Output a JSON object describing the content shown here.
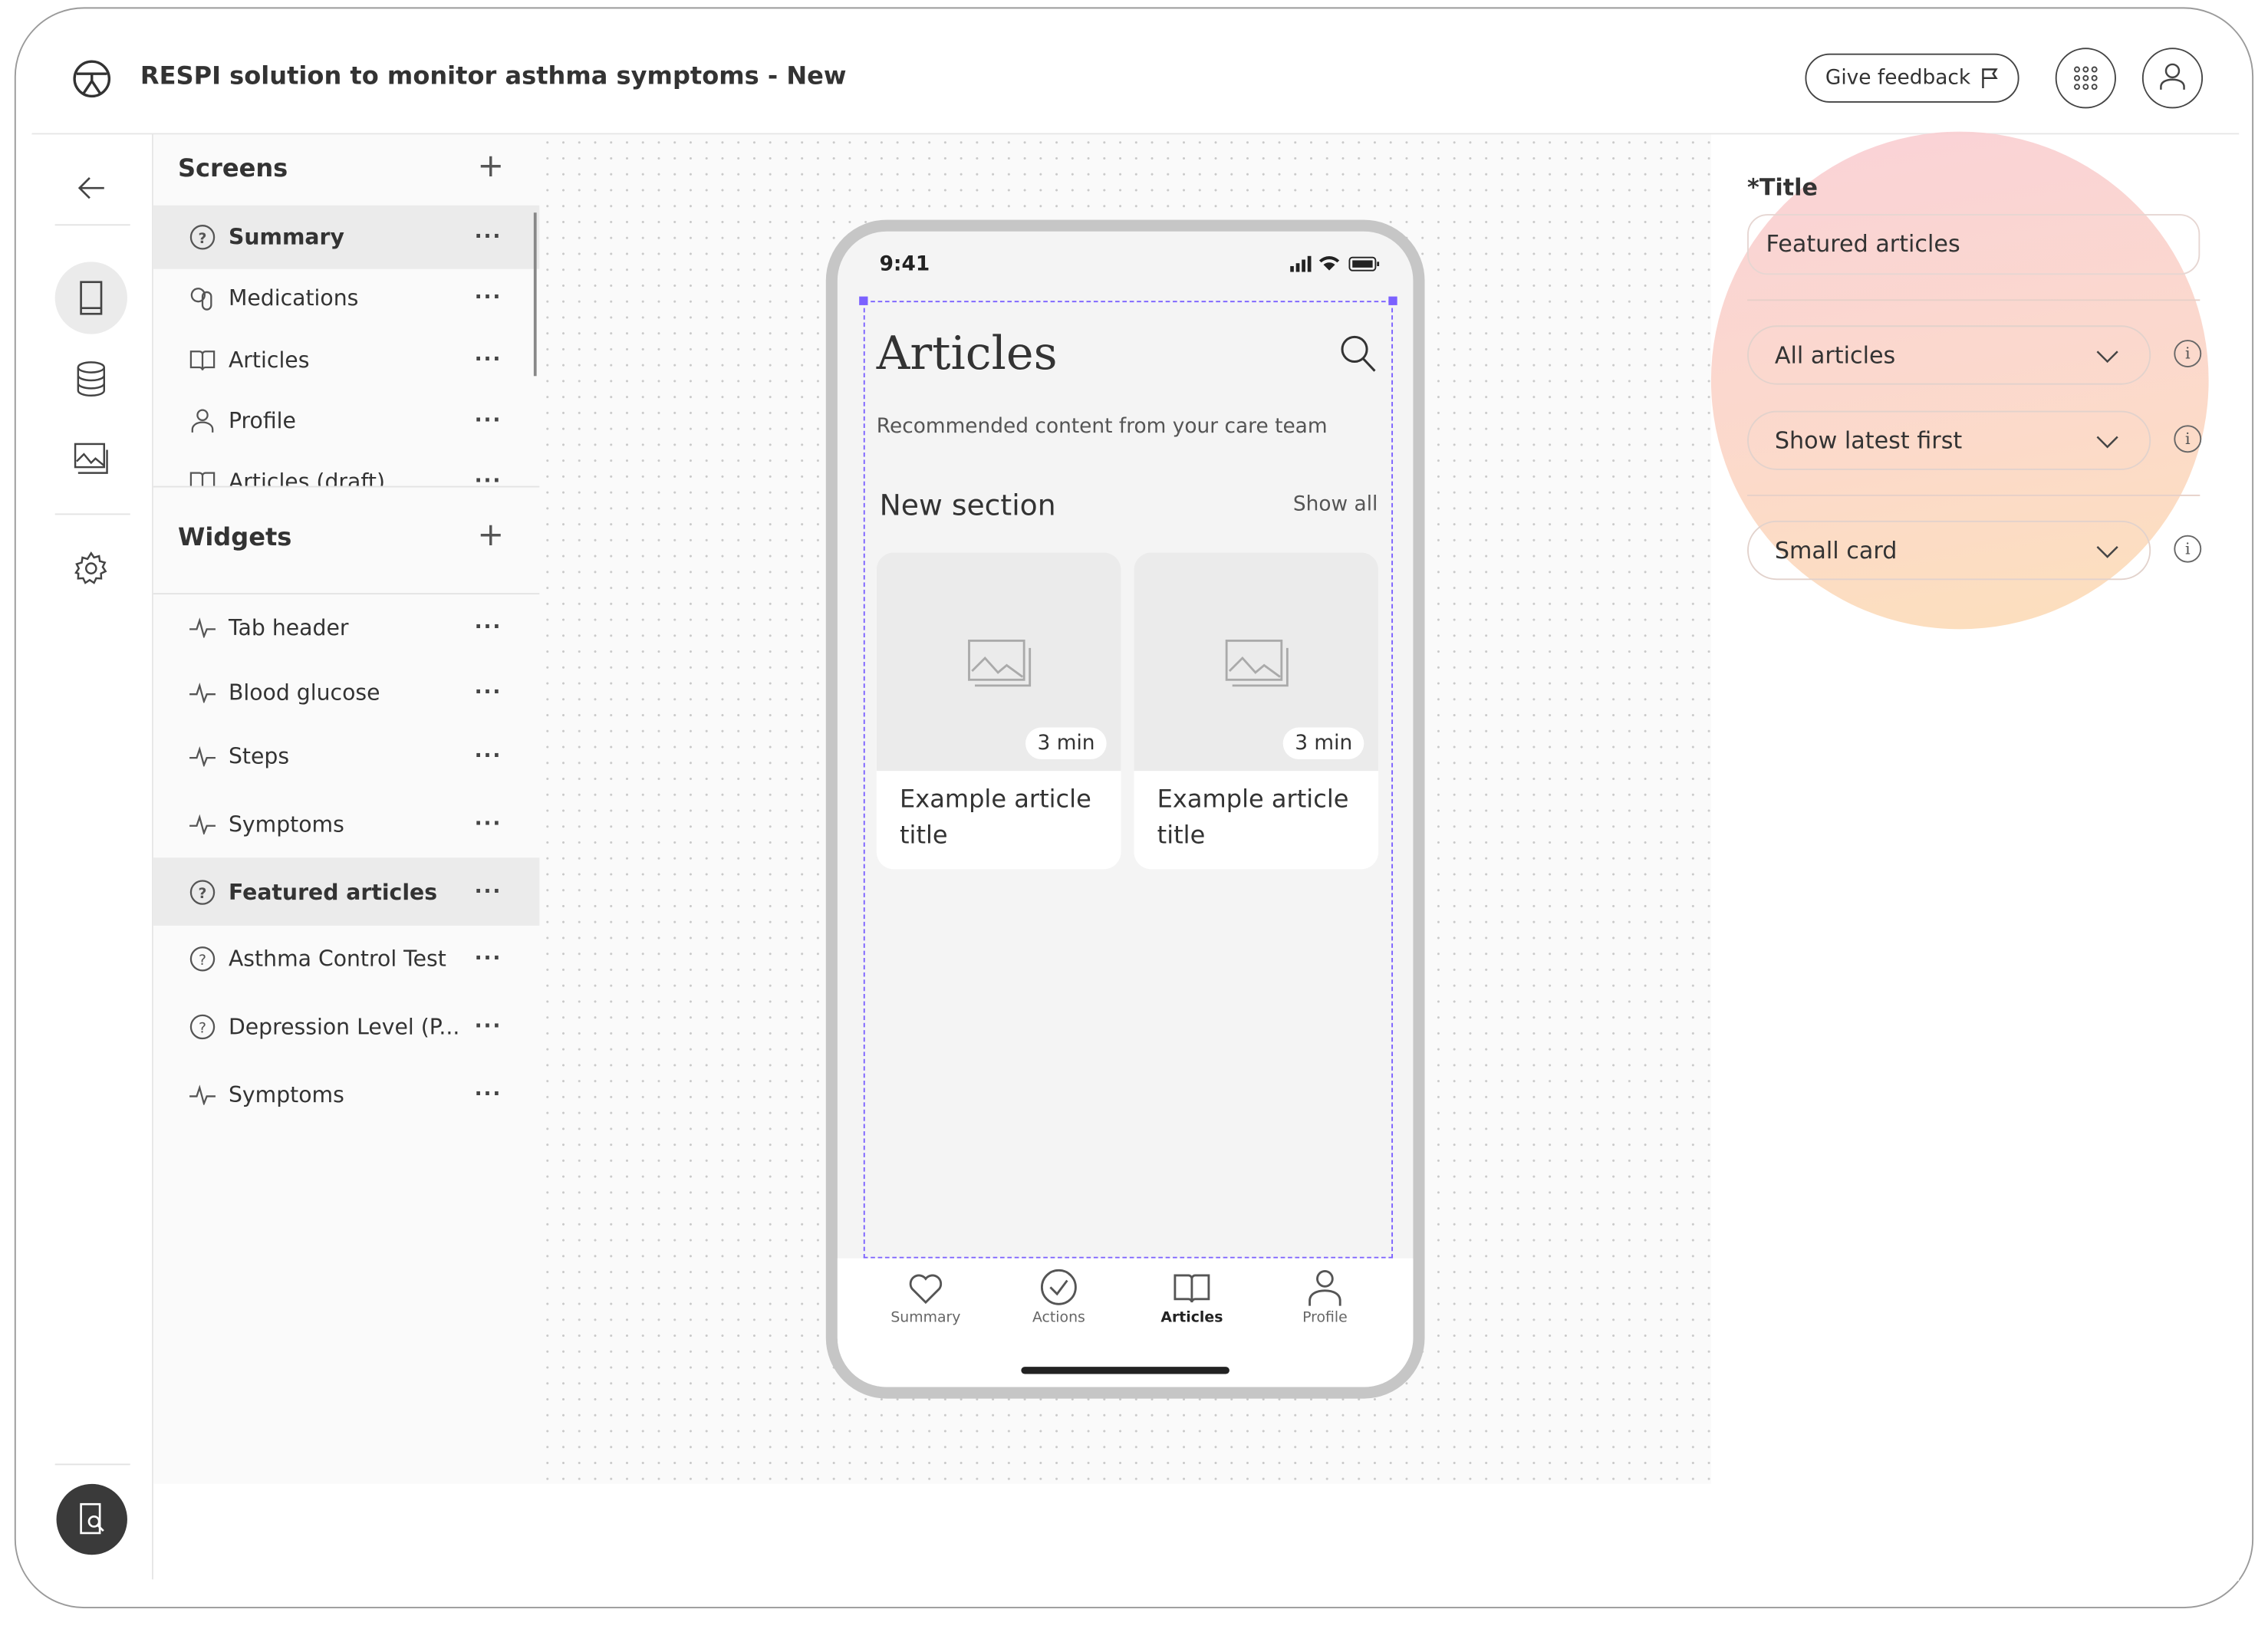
{
  "header": {
    "title": "RESPI solution to monitor asthma symptoms - New",
    "feedback_label": "Give feedback"
  },
  "rail": {
    "icons": [
      "back-arrow-icon",
      "phone-icon",
      "database-icon",
      "image-icon",
      "gear-icon",
      "preview-icon"
    ]
  },
  "screens": {
    "title": "Screens",
    "items": [
      {
        "label": "Summary",
        "icon": "question-circle-icon",
        "selected": true
      },
      {
        "label": "Medications",
        "icon": "pills-icon"
      },
      {
        "label": "Articles",
        "icon": "book-icon"
      },
      {
        "label": "Profile",
        "icon": "person-icon"
      },
      {
        "label": "Articles (draft)",
        "icon": "book-icon"
      }
    ]
  },
  "widgets": {
    "title": "Widgets",
    "items": [
      {
        "label": "Tab header",
        "icon": "pulse-icon"
      },
      {
        "label": "Blood glucose",
        "icon": "pulse-icon"
      },
      {
        "label": "Steps",
        "icon": "pulse-icon"
      },
      {
        "label": "Symptoms",
        "icon": "pulse-icon"
      },
      {
        "label": "Featured articles",
        "icon": "question-circle-icon",
        "selected": true
      },
      {
        "label": "Asthma Control Test",
        "icon": "question-circle-icon"
      },
      {
        "label": "Depression Level (P...",
        "icon": "question-circle-icon"
      },
      {
        "label": "Symptoms",
        "icon": "pulse-icon"
      }
    ]
  },
  "phone": {
    "time": "9:41",
    "title": "Articles",
    "subtitle": "Recommended content from your care team",
    "section": "New section",
    "show_all": "Show all",
    "cards": [
      {
        "duration": "3 min",
        "title": "Example article title"
      },
      {
        "duration": "3 min",
        "title": "Example article title"
      }
    ],
    "tabs": [
      {
        "label": "Summary"
      },
      {
        "label": "Actions"
      },
      {
        "label": "Articles",
        "active": true
      },
      {
        "label": "Profile"
      }
    ]
  },
  "panel": {
    "title_label": "*Title",
    "title_value": "Featured articles",
    "filter": "All articles",
    "sort": "Show latest first",
    "card_style": "Small card"
  },
  "colors": {
    "selection": "#7b61ff",
    "gradient_top": "#f9c6cc",
    "gradient_bottom": "#fbd3a8"
  }
}
